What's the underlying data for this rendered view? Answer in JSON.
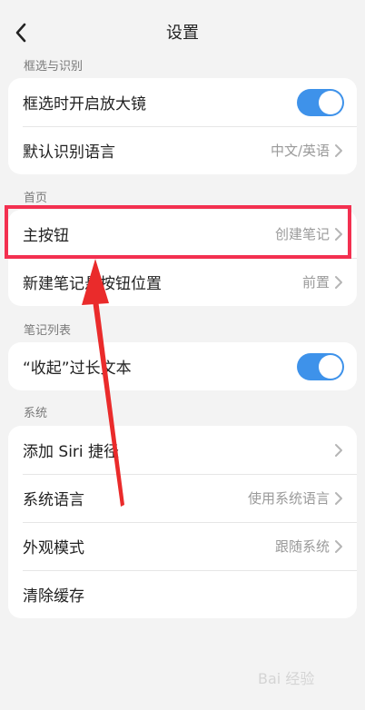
{
  "header": {
    "title": "设置",
    "back_icon": "chevron-left-icon"
  },
  "sections": [
    {
      "label": "框选与识别",
      "rows": [
        {
          "label": "框选时开启放大镜",
          "type": "toggle",
          "on": true
        },
        {
          "label": "默认识别语言",
          "type": "value",
          "value": "中文/英语"
        }
      ]
    },
    {
      "label": "首页",
      "rows": [
        {
          "label": "主按钮",
          "type": "value",
          "value": "创建笔记"
        },
        {
          "label": "新建笔记悬按钮位置",
          "type": "value",
          "value": "前置"
        }
      ]
    },
    {
      "label": "笔记列表",
      "rows": [
        {
          "label": "“收起”过长文本",
          "type": "toggle",
          "on": true
        }
      ]
    },
    {
      "label": "系统",
      "rows": [
        {
          "label": "添加 Siri 捷径",
          "type": "chevron"
        },
        {
          "label": "系统语言",
          "type": "value",
          "value": "使用系统语言"
        },
        {
          "label": "外观模式",
          "type": "value",
          "value": "跟随系统"
        },
        {
          "label": "清除缓存",
          "type": "plain"
        }
      ]
    }
  ],
  "colors": {
    "toggle_on": "#3e92ea",
    "highlight": "#f33050",
    "arrow": "#ea2b2b"
  },
  "watermark": {
    "text": "Bai 经验"
  }
}
